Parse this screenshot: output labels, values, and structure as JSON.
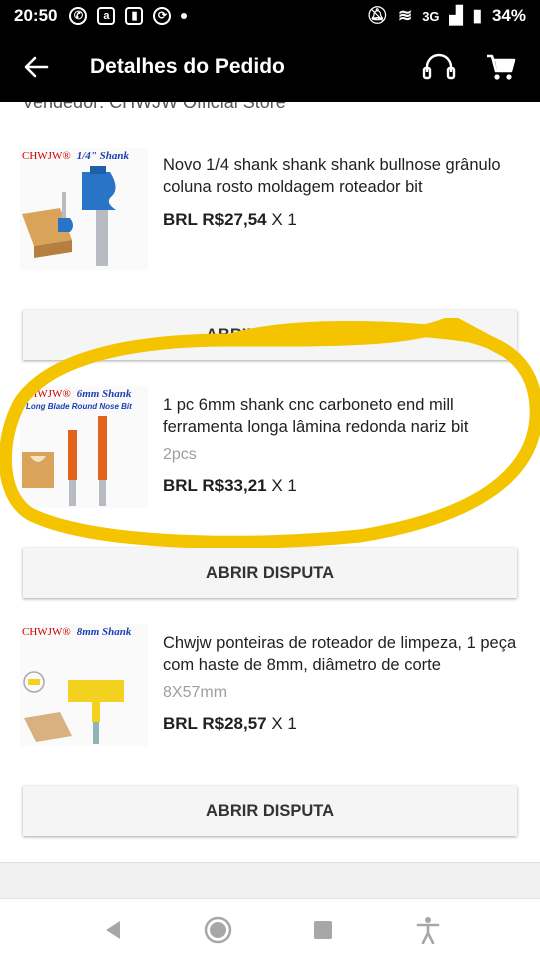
{
  "status_bar": {
    "time": "20:50",
    "network": "3G",
    "battery": "34%"
  },
  "app_bar": {
    "title": "Detalhes do Pedido"
  },
  "seller": {
    "label": "Vendedor: CHWJW Official Store"
  },
  "items": [
    {
      "brand": "CHWJW®",
      "thumb_title": "1/4\" Shank",
      "thumb_sub": "",
      "name": "Novo 1/4 shank shank shank bullnose grânulo coluna rosto moldagem roteador bit",
      "variant": "",
      "price": "BRL R$27,54",
      "qty": "X 1",
      "dispute": "ABRIR DISPUTA"
    },
    {
      "brand": "CHWJW®",
      "thumb_title": "6mm Shank",
      "thumb_sub": "Long Blade Round Nose Bit",
      "name": "1 pc 6mm shank cnc carboneto end mill ferramenta longa lâmina redonda nariz bit",
      "variant": "2pcs",
      "price": "BRL R$33,21",
      "qty": "X 1",
      "dispute": "ABRIR DISPUTA"
    },
    {
      "brand": "CHWJW®",
      "thumb_title": "8mm Shank",
      "thumb_sub": "",
      "name": "Chwjw ponteiras de roteador de limpeza, 1 peça com haste de 8mm, diâmetro de corte",
      "variant": "8X57mm",
      "price": "BRL R$28,57",
      "qty": "X 1",
      "dispute": "ABRIR DISPUTA"
    }
  ],
  "colors": {
    "bar": "#000000",
    "highlight": "#f5c400",
    "button": "#f5f5f5"
  },
  "icons": [
    "arrow-left-icon",
    "headset-icon",
    "cart-icon",
    "back-triangle-icon",
    "home-circle-icon",
    "recents-square-icon",
    "accessibility-icon"
  ]
}
